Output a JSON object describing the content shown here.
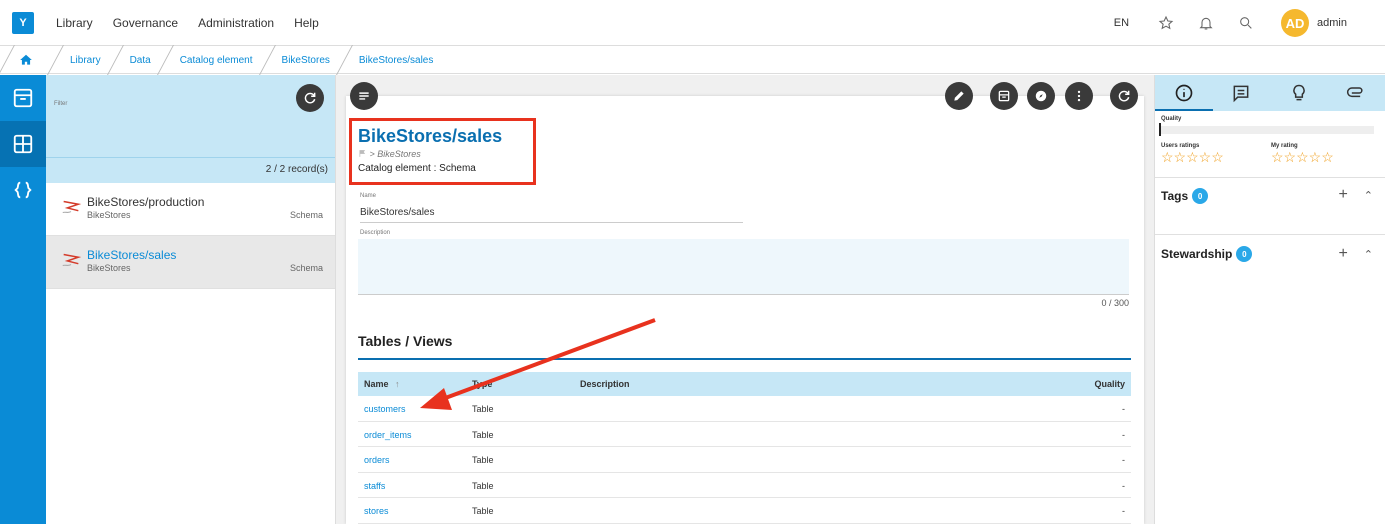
{
  "app": {
    "logo": "Y",
    "menu": [
      "Library",
      "Governance",
      "Administration",
      "Help"
    ],
    "lang": "EN",
    "user_initials": "AD",
    "user_name": "admin"
  },
  "breadcrumb": [
    "Library",
    "Data",
    "Catalog element",
    "BikeStores",
    "BikeStores/sales"
  ],
  "list_panel": {
    "filter_label": "Filter",
    "record_count": "2 / 2 record(s)",
    "items": [
      {
        "title": "BikeStores/production",
        "subtitle": "BikeStores",
        "type": "Schema"
      },
      {
        "title": "BikeStores/sales",
        "subtitle": "BikeStores",
        "type": "Schema"
      }
    ]
  },
  "detail": {
    "title": "BikeStores/sales",
    "path": "> BikeStores",
    "element_type": "Catalog element : Schema",
    "name_label": "Name",
    "name_value": "BikeStores/sales",
    "description_label": "Description",
    "description_count": "0 / 300",
    "section_title": "Tables / Views",
    "table_columns": {
      "name": "Name",
      "type": "Type",
      "description": "Description",
      "quality": "Quality"
    },
    "table_rows": [
      {
        "name": "customers",
        "type": "Table",
        "description": "",
        "quality": "-"
      },
      {
        "name": "order_items",
        "type": "Table",
        "description": "",
        "quality": "-"
      },
      {
        "name": "orders",
        "type": "Table",
        "description": "",
        "quality": "-"
      },
      {
        "name": "staffs",
        "type": "Table",
        "description": "",
        "quality": "-"
      },
      {
        "name": "stores",
        "type": "Table",
        "description": "",
        "quality": "-"
      }
    ]
  },
  "right_panel": {
    "quality_label": "Quality",
    "users_ratings_label": "Users ratings",
    "my_rating_label": "My rating",
    "stars": "☆☆☆☆☆",
    "tags_label": "Tags",
    "tags_count": "0",
    "stewardship_label": "Stewardship",
    "stewardship_count": "0"
  },
  "colors": {
    "accent": "#0a8bd6",
    "light_accent": "#c6e7f6",
    "annotation": "#e8321e",
    "avatar": "#f5b82e"
  }
}
